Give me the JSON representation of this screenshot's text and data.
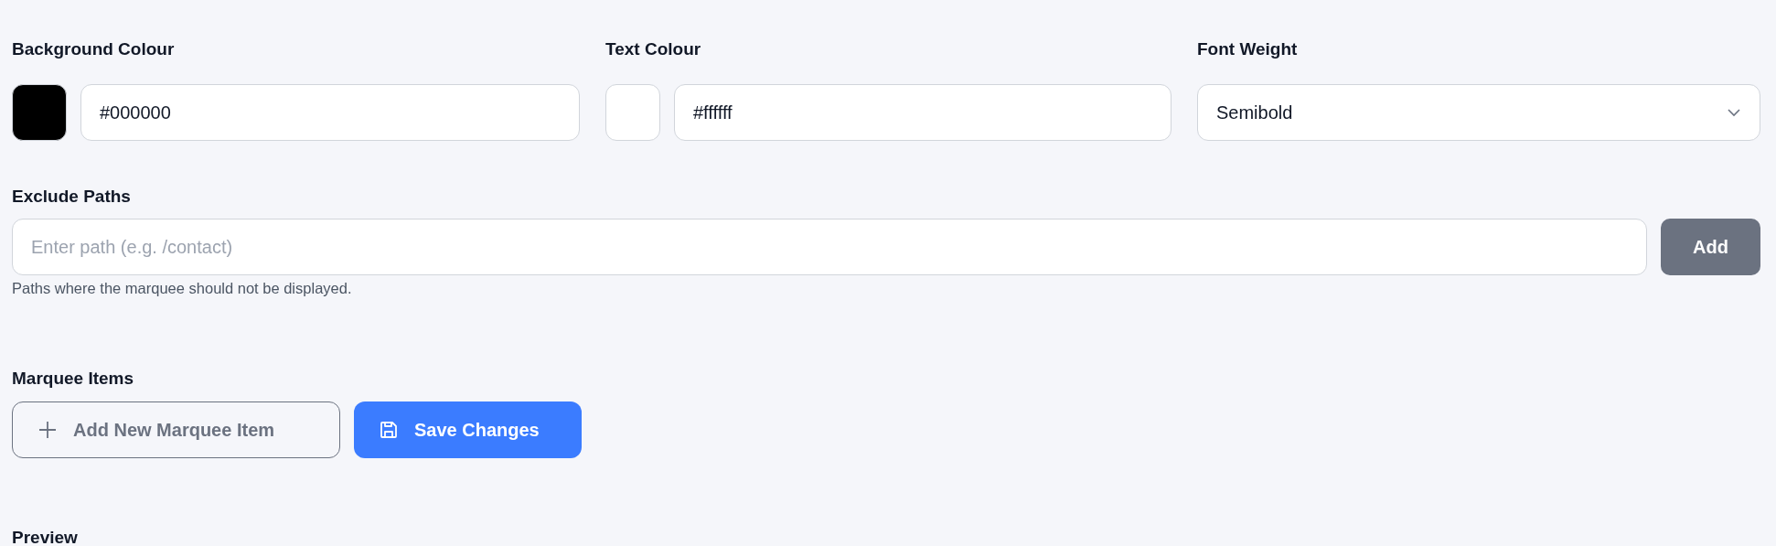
{
  "color_settings": [
    {
      "kind": "color",
      "label": "Background Colour",
      "value": "#000000",
      "color": "#000000"
    },
    {
      "kind": "color",
      "label": "Text Colour",
      "value": "#ffffff",
      "color": "#ffffff"
    },
    {
      "kind": "select",
      "label": "Font Weight",
      "value": "Semibold"
    }
  ],
  "exclude_paths": {
    "label": "Exclude Paths",
    "placeholder": "Enter path (e.g. /contact)",
    "button": "Add",
    "help": "Paths where the marquee should not be displayed."
  },
  "marquee_items": {
    "label": "Marquee Items",
    "buttons": [
      {
        "kind": "outline",
        "label": "Add New Marquee Item"
      },
      {
        "kind": "primary",
        "label": "Save Changes"
      }
    ]
  },
  "preview": {
    "label": "Preview"
  }
}
